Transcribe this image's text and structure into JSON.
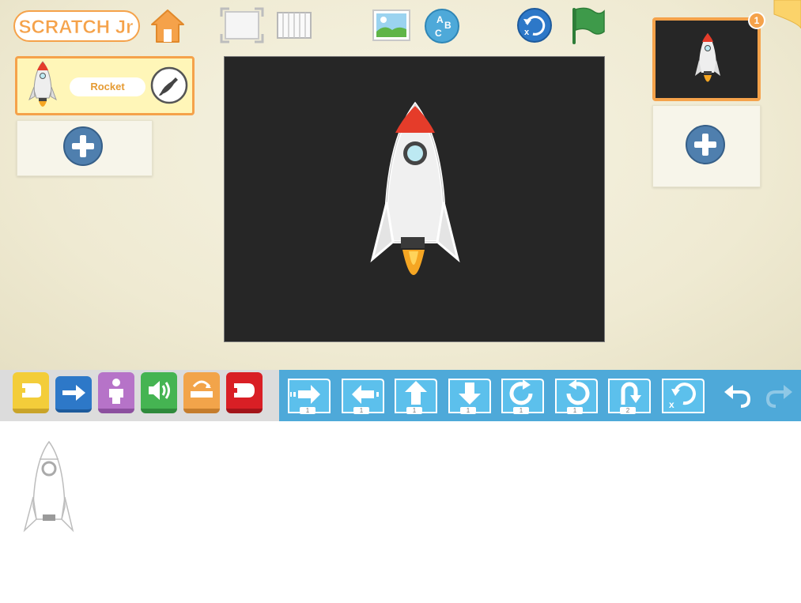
{
  "app": {
    "logo_text": "SCRATCH Jr"
  },
  "sprite": {
    "name": "Rocket"
  },
  "pages": {
    "current_page_number": "1"
  },
  "palette": {
    "categories": [
      {
        "name": "Triggering",
        "color": "#f3cd3a"
      },
      {
        "name": "Motion",
        "color": "#2d78c8"
      },
      {
        "name": "Looks",
        "color": "#b673c8"
      },
      {
        "name": "Sound",
        "color": "#45b452"
      },
      {
        "name": "Control",
        "color": "#f2a44a"
      },
      {
        "name": "End",
        "color": "#d91f25"
      }
    ],
    "block_numbers": [
      "1",
      "1",
      "1",
      "1",
      "1",
      "1",
      "2"
    ]
  },
  "colors": {
    "accent": "#f5a24a",
    "blocks_bar": "#4ea9d9",
    "stage": "#262626",
    "flag": "#3e9a4a"
  },
  "icons": [
    "home-icon",
    "fullscreen-icon",
    "grid-icon",
    "background-icon",
    "text-icon",
    "reset-icon",
    "green-flag-icon",
    "paint-brush-icon",
    "plus-icon",
    "undo-icon",
    "redo-icon"
  ]
}
